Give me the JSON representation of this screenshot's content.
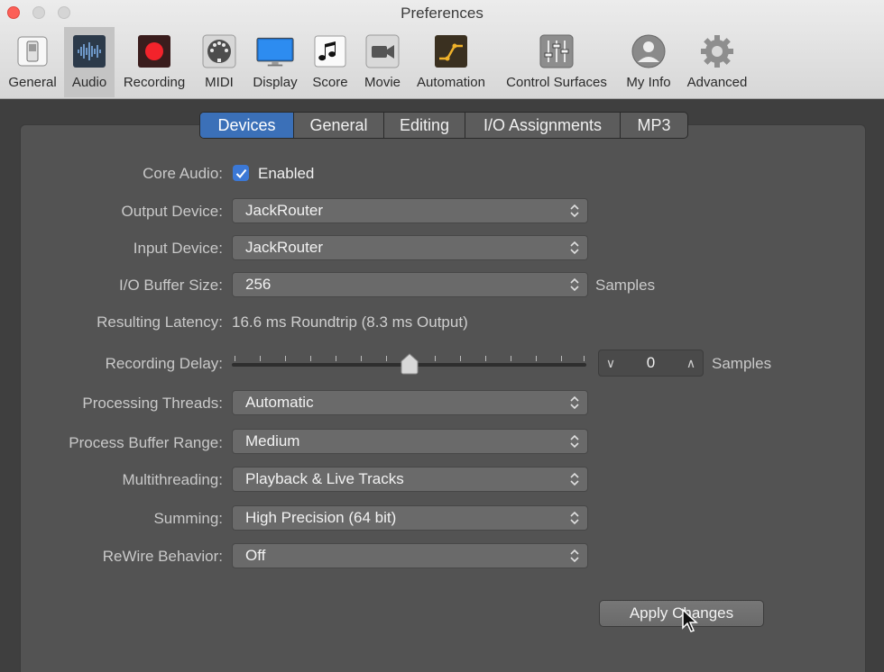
{
  "window": {
    "title": "Preferences"
  },
  "toolbar": {
    "items": [
      {
        "label": "General",
        "icon": "general-switch-icon"
      },
      {
        "label": "Audio",
        "icon": "audio-waveform-icon",
        "selected": true
      },
      {
        "label": "Recording",
        "icon": "record-icon"
      },
      {
        "label": "MIDI",
        "icon": "midi-connector-icon"
      },
      {
        "label": "Display",
        "icon": "display-monitor-icon"
      },
      {
        "label": "Score",
        "icon": "score-note-icon"
      },
      {
        "label": "Movie",
        "icon": "movie-camera-icon"
      },
      {
        "label": "Automation",
        "icon": "automation-curve-icon"
      },
      {
        "label": "Control Surfaces",
        "icon": "control-surfaces-faders-icon"
      },
      {
        "label": "My Info",
        "icon": "user-avatar-icon"
      },
      {
        "label": "Advanced",
        "icon": "gear-icon"
      }
    ]
  },
  "tabs": [
    {
      "label": "Devices",
      "selected": true
    },
    {
      "label": "General"
    },
    {
      "label": "Editing"
    },
    {
      "label": "I/O Assignments"
    },
    {
      "label": "MP3"
    }
  ],
  "devices": {
    "core_audio": {
      "label": "Core Audio:",
      "checkbox_label": "Enabled",
      "checked": true
    },
    "output_device": {
      "label": "Output Device:",
      "value": "JackRouter"
    },
    "input_device": {
      "label": "Input Device:",
      "value": "JackRouter"
    },
    "io_buffer_size": {
      "label": "I/O Buffer Size:",
      "value": "256",
      "unit": "Samples"
    },
    "resulting_latency": {
      "label": "Resulting Latency:",
      "value": "16.6 ms Roundtrip (8.3 ms Output)"
    },
    "recording_delay": {
      "label": "Recording Delay:",
      "value": "0",
      "unit": "Samples",
      "slider_position": 0.5
    },
    "processing_threads": {
      "label": "Processing Threads:",
      "value": "Automatic"
    },
    "process_buffer_range": {
      "label": "Process Buffer Range:",
      "value": "Medium"
    },
    "multithreading": {
      "label": "Multithreading:",
      "value": "Playback & Live Tracks"
    },
    "summing": {
      "label": "Summing:",
      "value": "High Precision (64 bit)"
    },
    "rewire_behavior": {
      "label": "ReWire Behavior:",
      "value": "Off"
    }
  },
  "apply_button": {
    "label": "Apply Changes"
  },
  "colors": {
    "accent": "#3b70b8",
    "panel": "#535353",
    "close": "#fc5f57"
  }
}
